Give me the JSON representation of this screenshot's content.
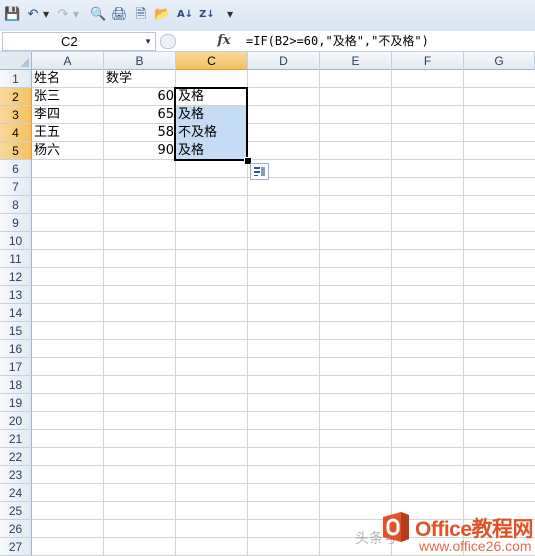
{
  "toolbar": {
    "icons": [
      "save-icon",
      "undo-icon",
      "redo-icon",
      "print-preview-icon",
      "print-icon",
      "new-icon",
      "open-icon",
      "sort-ascending-icon",
      "sort-descending-icon",
      "customize-icon"
    ]
  },
  "formula_bar": {
    "name_box": "C2",
    "fx_label": "fx",
    "formula": "=IF(B2>=60,\"及格\",\"不及格\")"
  },
  "columns": [
    "A",
    "B",
    "C",
    "D",
    "E",
    "F",
    "G"
  ],
  "rows": [
    "1",
    "2",
    "3",
    "4",
    "5",
    "6",
    "7",
    "8",
    "9",
    "10",
    "11",
    "12",
    "13",
    "14",
    "15",
    "16",
    "17",
    "18",
    "19",
    "20",
    "21",
    "22",
    "23",
    "24",
    "25",
    "26",
    "27"
  ],
  "cells": {
    "A1": "姓名",
    "B1": "数学",
    "A2": "张三",
    "B2": "60",
    "C2": "及格",
    "A3": "李四",
    "B3": "65",
    "C3": "及格",
    "A4": "王五",
    "B4": "58",
    "C4": "不及格",
    "A5": "杨六",
    "B5": "90",
    "C5": "及格"
  },
  "selection": {
    "active_cell": "C2",
    "range": "C2:C5"
  },
  "watermark": {
    "prefix": "头条号",
    "brand": "Office教程网",
    "url": "www.office26.com"
  }
}
